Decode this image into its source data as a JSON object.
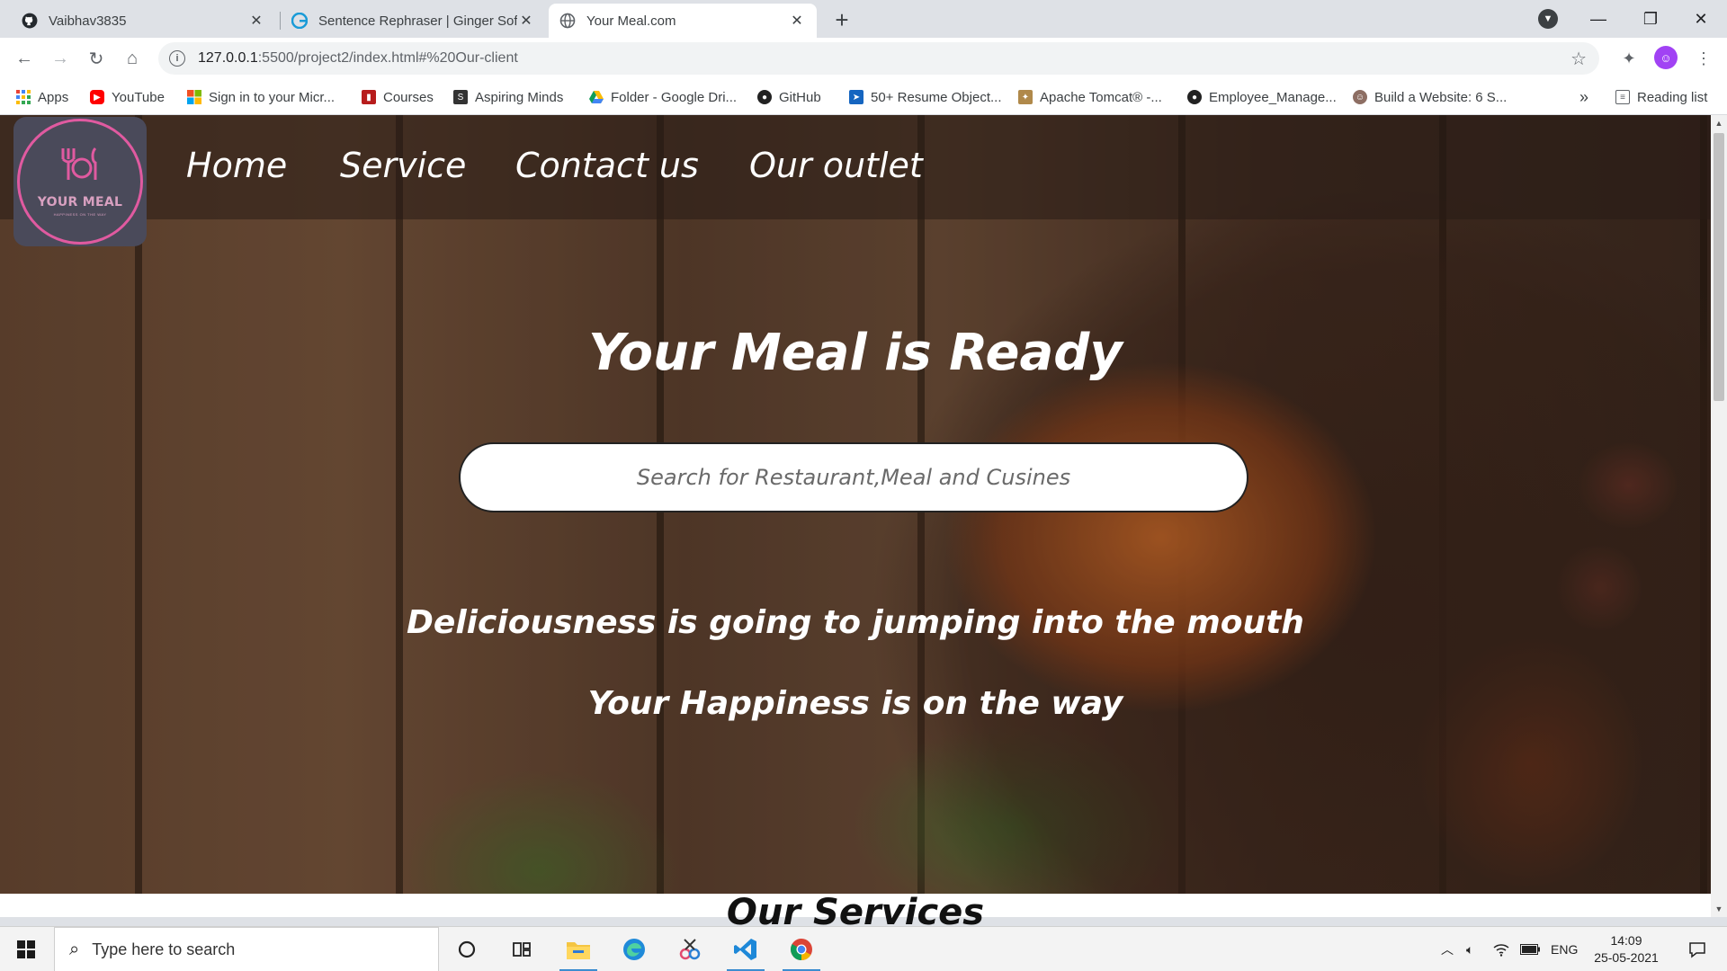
{
  "browser": {
    "tabs": [
      {
        "title": "Vaibhav3835",
        "icon": "github-icon",
        "active": false
      },
      {
        "title": "Sentence Rephraser | Ginger Software",
        "icon": "ginger-icon",
        "active": false
      },
      {
        "title": "Your Meal.com",
        "icon": "globe-icon",
        "active": true
      }
    ],
    "url_host": "127.0.0.1",
    "url_path": ":5500/project2/index.html#%20Our-client",
    "bookmarks": [
      {
        "label": "Apps",
        "icon": "apps-grid-icon",
        "color": "#4285f4"
      },
      {
        "label": "YouTube",
        "icon": "youtube-icon",
        "color": "#ff0000"
      },
      {
        "label": "Sign in to your Micr...",
        "icon": "microsoft-icon",
        "color": "#f25022"
      },
      {
        "label": "Courses",
        "icon": "courses-icon",
        "color": "#b71c1c"
      },
      {
        "label": "Aspiring Minds",
        "icon": "aspiring-minds-icon",
        "color": "#333333"
      },
      {
        "label": "Folder - Google Dri...",
        "icon": "google-drive-icon",
        "color": "#0f9d58"
      },
      {
        "label": "GitHub",
        "icon": "github-icon",
        "color": "#222222"
      },
      {
        "label": "50+ Resume Object...",
        "icon": "resume-icon",
        "color": "#1565c0"
      },
      {
        "label": "Apache Tomcat® -...",
        "icon": "tomcat-icon",
        "color": "#b0894a"
      },
      {
        "label": "Employee_Manage...",
        "icon": "github-icon",
        "color": "#222222"
      },
      {
        "label": "Build a Website: 6 S...",
        "icon": "avatar-icon",
        "color": "#8d6e63"
      }
    ],
    "more_bookmarks": "»",
    "reading_list": "Reading list"
  },
  "site": {
    "logo_brand": "YOUR MEAL",
    "logo_tagline": "HAPPINESS ON THE WAY",
    "nav": [
      "Home",
      "Service",
      "Contact us",
      "Our outlet"
    ],
    "hero_title": "Your Meal is Ready",
    "search_placeholder": "Search for Restaurant,Meal and Cusines",
    "subtitle_1": "Deliciousness is going to jumping into the mouth",
    "subtitle_2": "Your Happiness is on the way",
    "services_title": "Our Services"
  },
  "taskbar": {
    "search_placeholder": "Type here to search",
    "language": "ENG",
    "time": "14:09",
    "date": "25-05-2021",
    "accent": "#3c8dd0"
  }
}
